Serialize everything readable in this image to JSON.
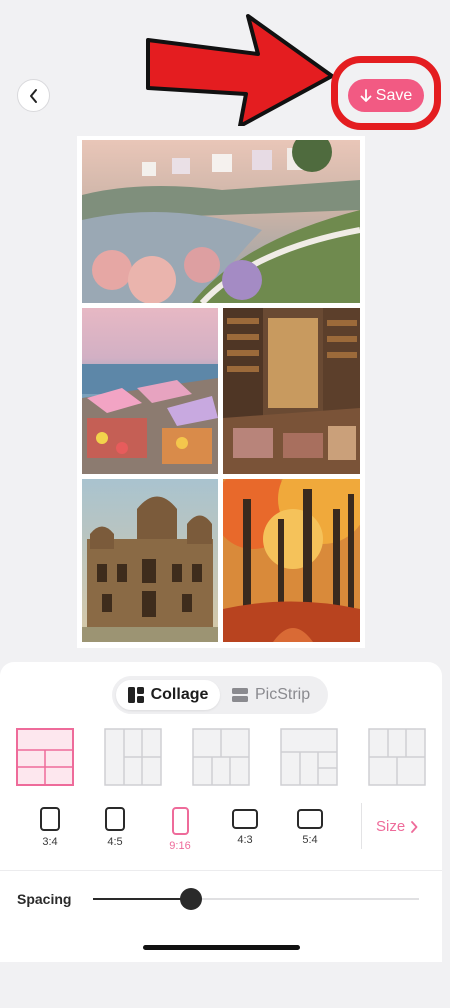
{
  "header": {
    "back_icon": "chevron-left-icon",
    "save_label": "Save",
    "save_icon": "arrow-down-icon",
    "accent": "#f25a83",
    "annotation_color": "#e41d20"
  },
  "collage": {
    "photos": [
      {
        "name": "seaside-cottages-photo"
      },
      {
        "name": "market-stalls-photo"
      },
      {
        "name": "bookshop-photo"
      },
      {
        "name": "palace-photo"
      },
      {
        "name": "autumn-forest-photo"
      }
    ]
  },
  "tabs": {
    "collage_label": "Collage",
    "collage_icon": "grid-icon",
    "picstrip_label": "PicStrip",
    "picstrip_icon": "strip-icon",
    "selected": "Collage"
  },
  "layouts": {
    "selected_index": 0,
    "count": 5
  },
  "ratios": {
    "items": [
      "3:4",
      "4:5",
      "9:16",
      "4:3",
      "5:4"
    ],
    "selected": "9:16"
  },
  "size": {
    "label": "Size"
  },
  "spacing": {
    "label": "Spacing",
    "value": 0.3
  }
}
